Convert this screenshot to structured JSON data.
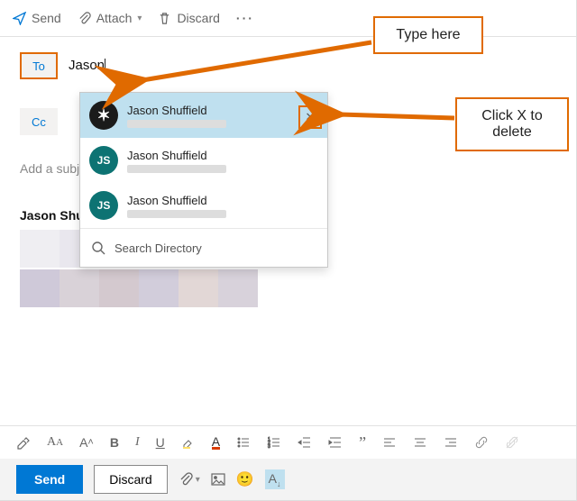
{
  "toolbar": {
    "send": "Send",
    "attach": "Attach",
    "discard": "Discard"
  },
  "fields": {
    "to_label": "To",
    "to_value": "Jason",
    "cc_label": "Cc",
    "subject_placeholder": "Add a subject"
  },
  "suggestions": [
    {
      "name": "Jason Shuffield",
      "initials": ""
    },
    {
      "name": "Jason Shuffield",
      "initials": "JS"
    },
    {
      "name": "Jason Shuffield",
      "initials": "JS"
    }
  ],
  "suggestions_footer": "Search Directory",
  "body": {
    "line1": "Jason Shufl"
  },
  "annotations": {
    "type_here": "Type here",
    "click_x": "Click X to delete"
  },
  "format": {
    "bold": "B",
    "italic": "I",
    "underline": "U"
  },
  "bottom": {
    "send": "Send",
    "discard": "Discard"
  },
  "colors": {
    "accent": "#0078d4",
    "annotation": "#e06a00"
  }
}
